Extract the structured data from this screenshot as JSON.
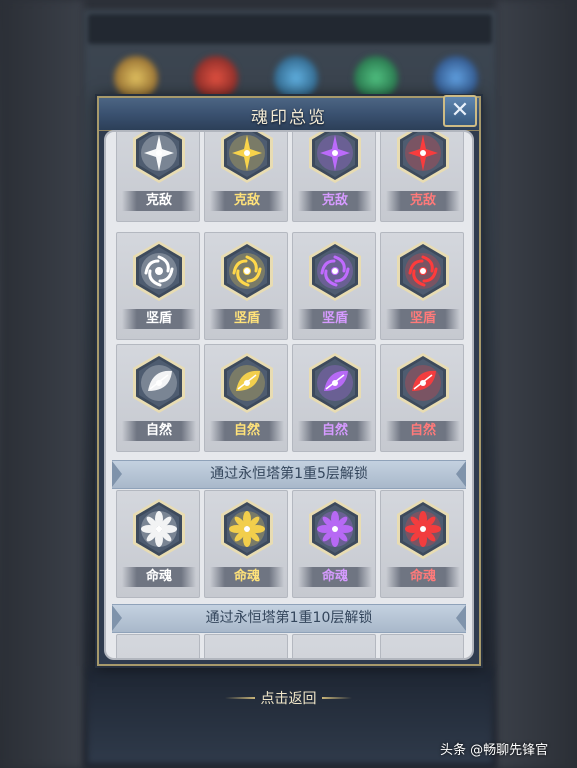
{
  "dialog": {
    "title": "魂印总览",
    "close_icon": "close-icon",
    "back_label": "点击返回"
  },
  "colors": {
    "white": "#ffffff",
    "yellow": "#ffd84a",
    "purple": "#c06bff",
    "red": "#ff3b3b"
  },
  "rows": [
    {
      "icon": "sparkle-icon",
      "items": [
        {
          "label": "克敌",
          "tier": "white"
        },
        {
          "label": "克敌",
          "tier": "yellow"
        },
        {
          "label": "克敌",
          "tier": "purple"
        },
        {
          "label": "克敌",
          "tier": "red"
        }
      ]
    },
    {
      "icon": "swirl-icon",
      "items": [
        {
          "label": "坚盾",
          "tier": "white"
        },
        {
          "label": "坚盾",
          "tier": "yellow"
        },
        {
          "label": "坚盾",
          "tier": "purple"
        },
        {
          "label": "坚盾",
          "tier": "red"
        }
      ]
    },
    {
      "icon": "leaf-icon",
      "items": [
        {
          "label": "自然",
          "tier": "white"
        },
        {
          "label": "自然",
          "tier": "yellow"
        },
        {
          "label": "自然",
          "tier": "purple"
        },
        {
          "label": "自然",
          "tier": "red"
        }
      ]
    },
    {
      "icon": "flower-icon",
      "items": [
        {
          "label": "命魂",
          "tier": "white"
        },
        {
          "label": "命魂",
          "tier": "yellow"
        },
        {
          "label": "命魂",
          "tier": "purple"
        },
        {
          "label": "命魂",
          "tier": "red"
        }
      ]
    }
  ],
  "unlock_banners": [
    "通过永恒塔第1重5层解锁",
    "通过永恒塔第1重10层解锁"
  ],
  "watermark": "头条 @畅聊先锋官"
}
